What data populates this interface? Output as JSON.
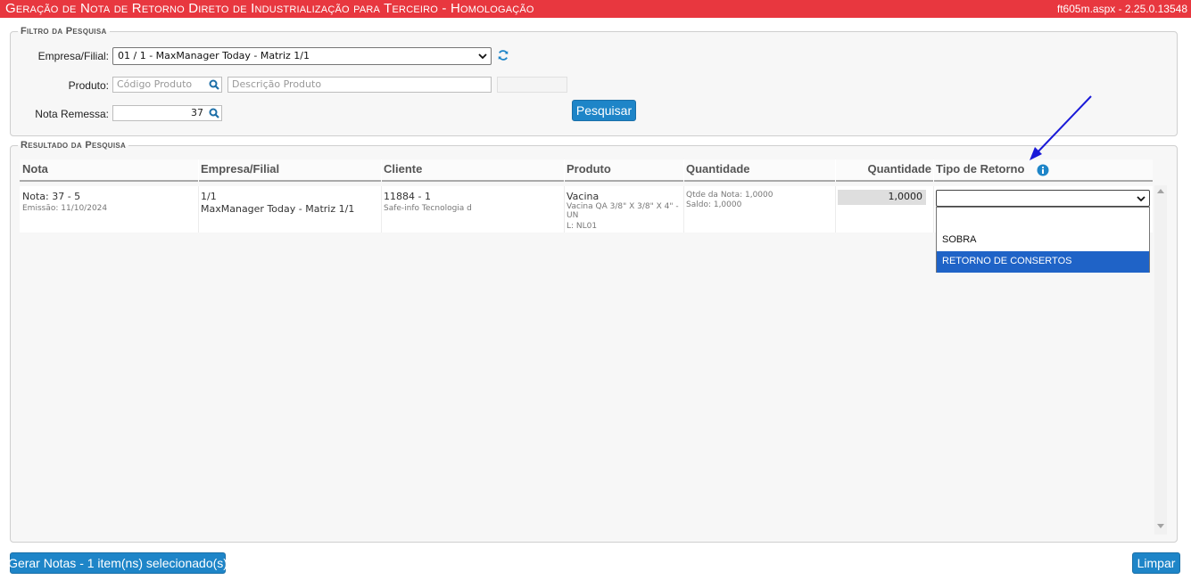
{
  "header": {
    "title": "Geração de Nota de Retorno Direto de Industrialização para Terceiro  - Homologação",
    "version": "ft605m.aspx - 2.25.0.13548",
    "color": "#e8373f"
  },
  "filter": {
    "legend": "Filtro da Pesquisa",
    "empresa_label": "Empresa/Filial:",
    "empresa_value": "01 / 1 - MaxManager Today - Matriz 1/1",
    "produto_label": "Produto:",
    "codigo_placeholder": "Código Produto",
    "descricao_placeholder": "Descrição Produto",
    "nota_label": "Nota Remessa:",
    "nota_value": "37",
    "search_button": "Pesquisar"
  },
  "results": {
    "legend": "Resultado da Pesquisa",
    "columns": [
      "Nota",
      "Empresa/Filial",
      "Cliente",
      "Produto",
      "Quantidade",
      "Quantidade",
      "Tipo de Retorno"
    ],
    "row": {
      "nota": "Nota: 37 - 5",
      "emissao": "Emissão: 11/10/2024",
      "empresa_code": "1/1",
      "empresa_name": "MaxManager Today - Matriz 1/1",
      "cliente_code": "11884 - 1",
      "cliente_name": "Safe-info Tecnologia d",
      "produto_name": "Vacina",
      "produto_desc": "Vacina QA 3/8\" X 3/8\" X 4\" - UN",
      "produto_lote": "L: NL01",
      "qtde_nota": "Qtde da Nota: 1,0000",
      "saldo": "Saldo: 1,0000",
      "quantidade": "1,0000",
      "tipo_retorno_selected": ""
    },
    "dropdown_options": [
      "",
      "SOBRA",
      "RETORNO DE CONSERTOS"
    ],
    "highlighted_option_index": 2
  },
  "footer": {
    "gerar_button": "Gerar Notas - 1 item(ns) selecionado(s)",
    "limpar_button": "Limpar"
  },
  "colors": {
    "accent_blue": "#1e85c8",
    "annotation_arrow": "#1a1ad8",
    "option_highlight": "#1f63c7"
  }
}
